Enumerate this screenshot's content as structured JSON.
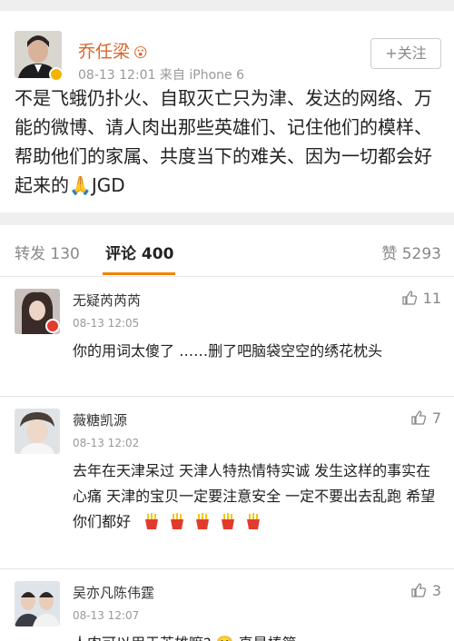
{
  "post": {
    "author": "乔任梁",
    "crown_icon": "crown-emoji",
    "meta": "08-13 12:01  来自 iPhone 6",
    "follow_label": "+关注",
    "text": "不是飞蛾仍扑火、自取灭亡只为津、发达的网络、万能的微博、请人肉出那些英雄们、记住他们的模样、帮助他们的家属、共度当下的难关、因为一切都会好起来的🙏JGD"
  },
  "tabs": {
    "repost": "转发 130",
    "comments": "评论 400",
    "likes": "赞 5293"
  },
  "comments": [
    {
      "name": "无疑芮芮芮",
      "time": "08-13 12:05",
      "likes": "11",
      "text": "你的用词太傻了 ……删了吧脑袋空空的绣花枕头"
    },
    {
      "name": "薇糖凯源",
      "time": "08-13 12:02",
      "likes": "7",
      "text": "去年在天津呆过 天津人特热情特实诚 发生这样的事实在心痛 天津的宝贝一定要注意安全 一定不要出去乱跑 希望你们都好"
    },
    {
      "name": "吴亦凡陈伟霆",
      "time": "08-13 12:07",
      "likes": "3",
      "text": "人肉可以用于英雄嘛? 🙁 真是棒简"
    }
  ],
  "colors": {
    "author": "#d8652b",
    "accent": "#f08300",
    "badge_gold": "#f5b400",
    "badge_red": "#e23b2e"
  }
}
